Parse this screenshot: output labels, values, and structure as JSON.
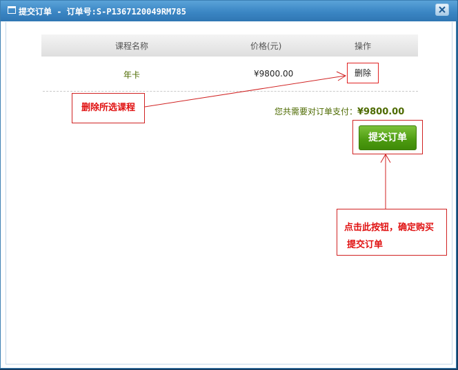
{
  "window": {
    "title": "提交订单 - 订单号:S-P1367120049RM785"
  },
  "table": {
    "headers": [
      "课程名称",
      "价格(元)",
      "操作"
    ],
    "rows": [
      {
        "course": "年卡",
        "price": "¥9800.00",
        "action": "删除"
      }
    ]
  },
  "summary": {
    "label": "您共需要对订单支付：",
    "amount": "¥9800.00"
  },
  "actions": {
    "submit_label": "提交订单"
  },
  "annotations": {
    "delete_note": "删除所选课程",
    "submit_note_line1": "点击此按钮，确定购买",
    "submit_note_line2": "提交订单"
  },
  "colors": {
    "titlebar": "#3b86c4",
    "annotation_red": "#e01010",
    "submit_green": "#4c9a10",
    "text_olive": "#4d6a00"
  },
  "icons": {
    "title": "window-icon",
    "close": "close-icon"
  }
}
